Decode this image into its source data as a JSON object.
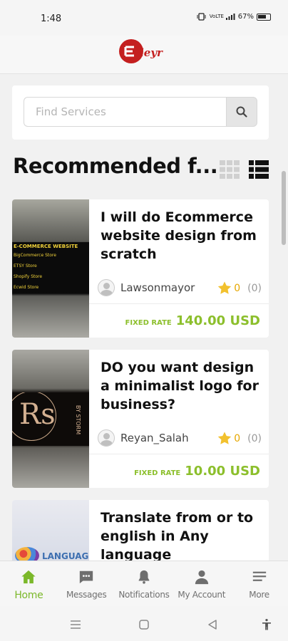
{
  "status_bar": {
    "time": "1:48",
    "network": "VoLTE",
    "battery": "67%"
  },
  "header": {
    "logo_text": "Etleyr"
  },
  "search": {
    "placeholder": "Find Services",
    "button_icon": "search-icon"
  },
  "section": {
    "title": "Recommended f...",
    "grid_icon": "grid-view-icon",
    "list_icon": "list-view-icon"
  },
  "gigs": [
    {
      "title": "I will do Ecommerce website design from scratch",
      "thumb_heading": "E-COMMERCE WEBSITE",
      "thumb_lines": [
        "BigCommerce Store",
        "ETSY Store",
        "Shopify Store",
        "Ecwid Store"
      ],
      "seller": "Lawsonmayor",
      "rating": "0",
      "reviews": "(0)",
      "price_label": "FIXED RATE",
      "price": "140.00 USD"
    },
    {
      "title": "DO you want design a minimalist logo for business?",
      "thumb_heading": "Rs",
      "thumb_sub": "BY STORM",
      "seller": "Reyan_Salah",
      "rating": "0",
      "reviews": "(0)",
      "price_label": "FIXED RATE",
      "price": "10.00 USD"
    },
    {
      "title": "Translate from or to english in Any language",
      "thumb_heading": "LANGUAGE"
    }
  ],
  "bottom_nav": [
    {
      "label": "Home",
      "icon": "home-icon",
      "active": true
    },
    {
      "label": "Messages",
      "icon": "message-icon",
      "active": false
    },
    {
      "label": "Notifications",
      "icon": "bell-icon",
      "active": false
    },
    {
      "label": "My Account",
      "icon": "user-icon",
      "active": false
    },
    {
      "label": "More",
      "icon": "menu-icon",
      "active": false
    }
  ],
  "colors": {
    "accent": "#7bb82a",
    "price": "#8cbf2c",
    "star": "#f2c12e",
    "logo": "#c41f1f"
  }
}
